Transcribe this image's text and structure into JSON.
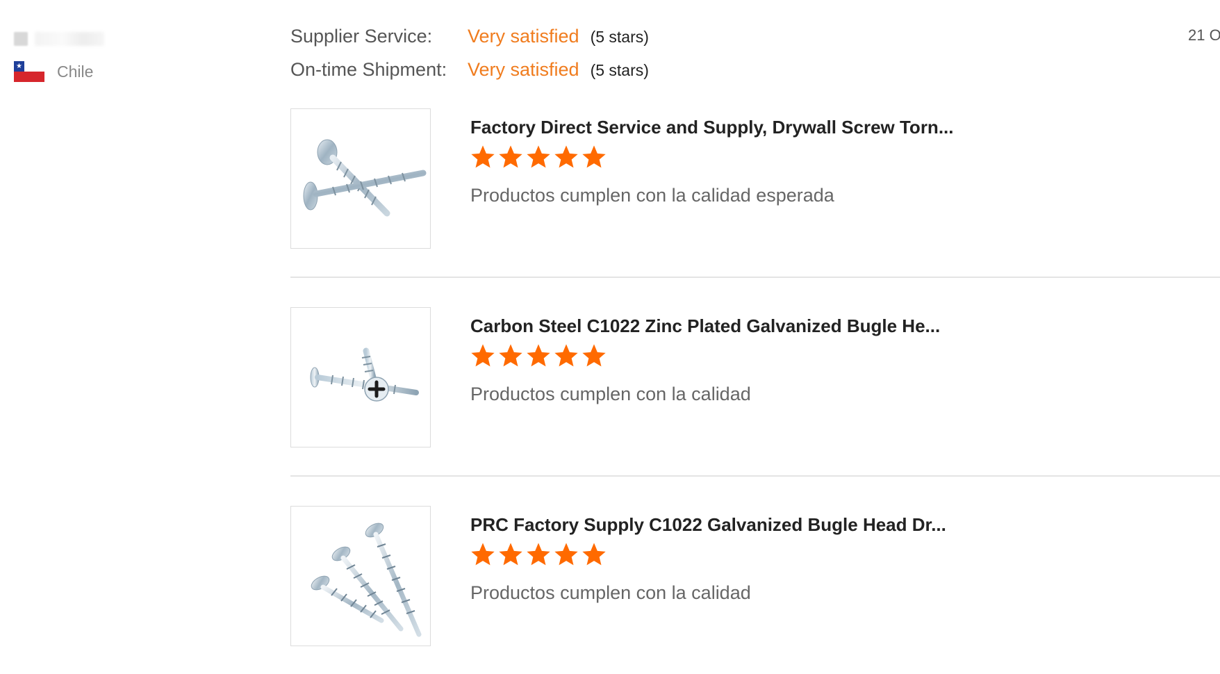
{
  "reviewer": {
    "country": "Chile",
    "flag_icon": "chile-flag-icon"
  },
  "date_fragment": "21 O",
  "ratings": [
    {
      "label": "Supplier Service:",
      "value": "Very satisfied",
      "stars_text": "(5 stars)"
    },
    {
      "label": "On-time Shipment:",
      "value": "Very satisfied",
      "stars_text": "(5 stars)"
    }
  ],
  "colors": {
    "accent": "#f07c1e",
    "star": "#ff6a00",
    "divider": "#e4e4e4"
  },
  "reviews": [
    {
      "title": "Factory Direct Service and Supply, Drywall Screw Torn...",
      "rating": 5,
      "text": "Productos cumplen con la calidad esperada",
      "image_icon": "crossed-drywall-screws-image"
    },
    {
      "title": "Carbon Steel C1022 Zinc Plated Galvanized Bugle He...",
      "rating": 5,
      "text": "Productos cumplen con la calidad",
      "image_icon": "phillips-drywall-screws-image"
    },
    {
      "title": "PRC Factory Supply C1022 Galvanized Bugle Head Dr...",
      "rating": 5,
      "text": "Productos cumplen con la calidad",
      "image_icon": "three-galvanized-screws-image"
    }
  ]
}
